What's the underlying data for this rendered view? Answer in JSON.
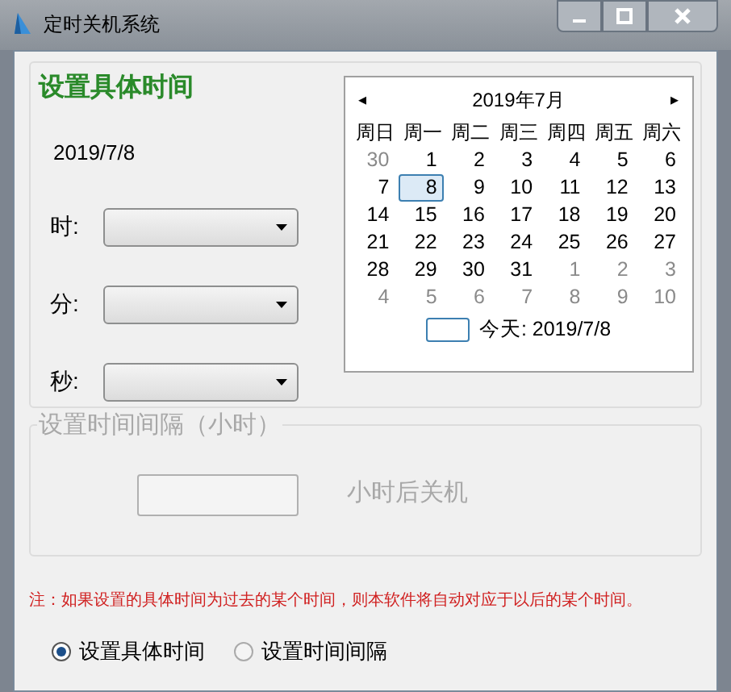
{
  "window": {
    "title": "定时关机系统"
  },
  "specific": {
    "title": "设置具体时间",
    "date": "2019/7/8",
    "fields": [
      {
        "label": "时:"
      },
      {
        "label": "分:"
      },
      {
        "label": "秒:"
      }
    ]
  },
  "calendar": {
    "prev": "◂",
    "next": "▸",
    "month": "2019年7月",
    "weekdays": [
      "周日",
      "周一",
      "周二",
      "周三",
      "周四",
      "周五",
      "周六"
    ],
    "days": [
      {
        "label": "30",
        "muted": true,
        "selected": false
      },
      {
        "label": "1",
        "muted": false,
        "selected": false
      },
      {
        "label": "2",
        "muted": false,
        "selected": false
      },
      {
        "label": "3",
        "muted": false,
        "selected": false
      },
      {
        "label": "4",
        "muted": false,
        "selected": false
      },
      {
        "label": "5",
        "muted": false,
        "selected": false
      },
      {
        "label": "6",
        "muted": false,
        "selected": false
      },
      {
        "label": "7",
        "muted": false,
        "selected": false
      },
      {
        "label": "8",
        "muted": false,
        "selected": true
      },
      {
        "label": "9",
        "muted": false,
        "selected": false
      },
      {
        "label": "10",
        "muted": false,
        "selected": false
      },
      {
        "label": "11",
        "muted": false,
        "selected": false
      },
      {
        "label": "12",
        "muted": false,
        "selected": false
      },
      {
        "label": "13",
        "muted": false,
        "selected": false
      },
      {
        "label": "14",
        "muted": false,
        "selected": false
      },
      {
        "label": "15",
        "muted": false,
        "selected": false
      },
      {
        "label": "16",
        "muted": false,
        "selected": false
      },
      {
        "label": "17",
        "muted": false,
        "selected": false
      },
      {
        "label": "18",
        "muted": false,
        "selected": false
      },
      {
        "label": "19",
        "muted": false,
        "selected": false
      },
      {
        "label": "20",
        "muted": false,
        "selected": false
      },
      {
        "label": "21",
        "muted": false,
        "selected": false
      },
      {
        "label": "22",
        "muted": false,
        "selected": false
      },
      {
        "label": "23",
        "muted": false,
        "selected": false
      },
      {
        "label": "24",
        "muted": false,
        "selected": false
      },
      {
        "label": "25",
        "muted": false,
        "selected": false
      },
      {
        "label": "26",
        "muted": false,
        "selected": false
      },
      {
        "label": "27",
        "muted": false,
        "selected": false
      },
      {
        "label": "28",
        "muted": false,
        "selected": false
      },
      {
        "label": "29",
        "muted": false,
        "selected": false
      },
      {
        "label": "30",
        "muted": false,
        "selected": false
      },
      {
        "label": "31",
        "muted": false,
        "selected": false
      },
      {
        "label": "1",
        "muted": true,
        "selected": false
      },
      {
        "label": "2",
        "muted": true,
        "selected": false
      },
      {
        "label": "3",
        "muted": true,
        "selected": false
      },
      {
        "label": "4",
        "muted": true,
        "selected": false
      },
      {
        "label": "5",
        "muted": true,
        "selected": false
      },
      {
        "label": "6",
        "muted": true,
        "selected": false
      },
      {
        "label": "7",
        "muted": true,
        "selected": false
      },
      {
        "label": "8",
        "muted": true,
        "selected": false
      },
      {
        "label": "9",
        "muted": true,
        "selected": false
      },
      {
        "label": "10",
        "muted": true,
        "selected": false
      }
    ],
    "today": "今天: 2019/7/8"
  },
  "interval": {
    "title": "设置时间间隔（小时）",
    "disabled": true,
    "suffix": "小时后关机"
  },
  "note": "注：如果设置的具体时间为过去的某个时间，则本软件将自动对应于以后的某个时间。",
  "modes": [
    {
      "label": "设置具体时间",
      "selected": true
    },
    {
      "label": "设置时间间隔",
      "selected": false
    }
  ]
}
